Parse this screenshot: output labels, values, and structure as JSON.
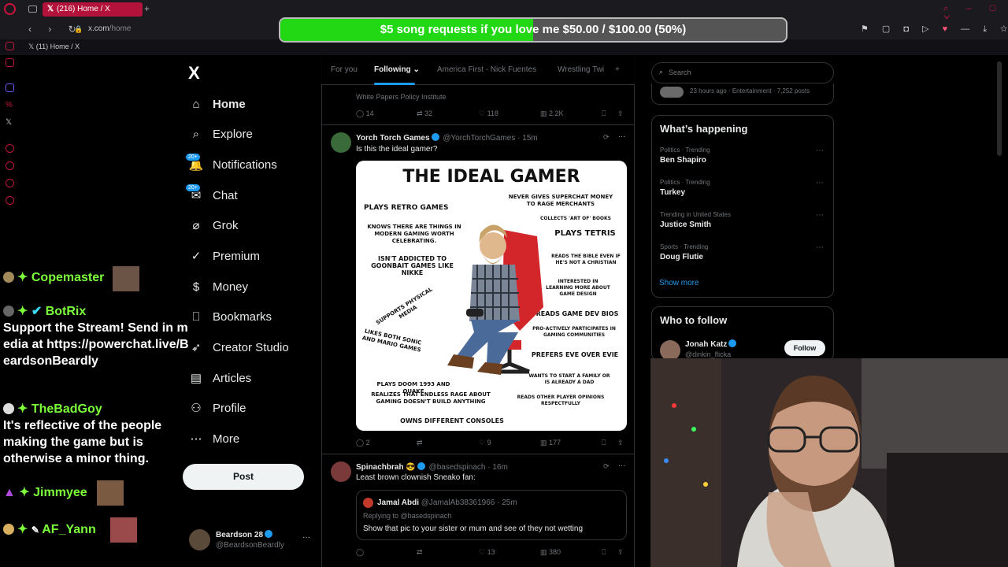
{
  "browser": {
    "tab_title": "(216) Home / X",
    "url_host": "x.com",
    "url_path": "/home",
    "bookmark": "(11) Home / X",
    "ai_label": "AI"
  },
  "donation": {
    "text": "$5 song requests if you love me $50.00 / $100.00 (50%)",
    "progress": 0.5
  },
  "nav": {
    "logo": "X",
    "items": [
      {
        "label": "Home",
        "icon": "home-icon",
        "glyph": "⌂"
      },
      {
        "label": "Explore",
        "icon": "search-icon",
        "glyph": "⌕"
      },
      {
        "label": "Notifications",
        "icon": "bell-icon",
        "glyph": "🔔",
        "badge": "20+"
      },
      {
        "label": "Chat",
        "icon": "envelope-icon",
        "glyph": "✉",
        "badge": "20+"
      },
      {
        "label": "Grok",
        "icon": "grok-icon",
        "glyph": "⌀"
      },
      {
        "label": "Premium",
        "icon": "premium-icon",
        "glyph": "✓"
      },
      {
        "label": "Money",
        "icon": "money-icon",
        "glyph": "$"
      },
      {
        "label": "Bookmarks",
        "icon": "bookmark-icon",
        "glyph": "⎕"
      },
      {
        "label": "Creator Studio",
        "icon": "rocket-icon",
        "glyph": "➶"
      },
      {
        "label": "Articles",
        "icon": "articles-icon",
        "glyph": "▤"
      },
      {
        "label": "Profile",
        "icon": "person-icon",
        "glyph": "⚇"
      },
      {
        "label": "More",
        "icon": "more-icon",
        "glyph": "⋯"
      }
    ],
    "post_button": "Post",
    "account": {
      "name": "Beardson 28",
      "handle": "@BeardsonBeardly",
      "more": "···"
    }
  },
  "chat": [
    {
      "user": "Copemaster",
      "message": ""
    },
    {
      "user": "BotRix",
      "message": "Support the Stream! Send in media at https://powerchat.live/BeardsonBeardly"
    },
    {
      "user": "TheBadGoy",
      "message": "It's reflective of the people making the game but is otherwise a minor thing."
    },
    {
      "user": "Jimmyee",
      "message": ""
    },
    {
      "user": "AF_Yann",
      "message": ""
    }
  ],
  "feed": {
    "tabs": [
      "For you",
      "Following",
      "America First - Nick Fuentes",
      "Wrestling Twi",
      "+"
    ],
    "prev_post": {
      "source": "White Papers Policy Institute",
      "replies": "14",
      "reposts": "32",
      "likes": "118",
      "views": "2.2K"
    },
    "post1": {
      "name": "Yorch Torch Games",
      "handle": "@YorchTorchGames · 15m",
      "text": "Is this the ideal gamer?",
      "replies": "2",
      "reposts": "",
      "likes": "9",
      "views": "177",
      "meme": {
        "title": "THE IDEAL GAMER",
        "labels": [
          "PLAYS RETRO GAMES",
          "KNOWS THERE ARE THINGS IN MODERN GAMING WORTH CELEBRATING.",
          "ISN'T ADDICTED TO GOONBAIT GAMES LIKE NIKKE",
          "SUPPORTS PHYSICAL MEDIA",
          "LIKES BOTH SONIC AND MARIO GAMES",
          "PLAYS DOOM 1993 AND QUAKE",
          "REALIZES THAT ENDLESS RAGE ABOUT GAMING DOESN'T BUILD ANYTHING",
          "OWNS DIFFERENT CONSOLES",
          "NEVER GIVES SUPERCHAT MONEY TO RAGE MERCHANTS",
          "COLLECTS 'ART OF' BOOKS",
          "PLAYS TETRIS",
          "READS THE BIBLE EVEN IF HE'S NOT A CHRISTIAN",
          "INTERESTED IN LEARNING MORE ABOUT GAME DESIGN",
          "READS GAME DEV BIOS",
          "PRO-ACTIVELY PARTICIPATES IN GAMING COMMUNITIES",
          "PREFERS EVE OVER EVIE",
          "WANTS TO START A FAMILY OR IS ALREADY A DAD",
          "READS OTHER PLAYER OPINIONS RESPECTFULLY"
        ]
      }
    },
    "post2": {
      "name": "Spinachbrah",
      "handle": "@basedspinach · 16m",
      "text": "Least brown clownish Sneako fan:",
      "quote": {
        "name": "Jamal Abdi",
        "handle": "@JamalAb38361966 · 25m",
        "reply": "Replying to @basedspinach",
        "text": "Show that pic to your sister or mum and see of they not wetting"
      },
      "replies": "",
      "reposts": "",
      "likes": "13",
      "views": "380"
    }
  },
  "right": {
    "search_placeholder": "Search",
    "news_meta": "23 hours ago · Entertainment · 7,252 posts",
    "happening_title": "What’s happening",
    "trends": [
      {
        "context": "Politics · Trending",
        "name": "Ben Shapiro"
      },
      {
        "context": "Politics · Trending",
        "name": "Turkey"
      },
      {
        "context": "Trending in United States",
        "name": "Justice Smith"
      },
      {
        "context": "Sports · Trending",
        "name": "Doug Flutie"
      }
    ],
    "show_more": "Show more",
    "wtf_title": "Who to follow",
    "suggestion": {
      "name": "Jonah Katz",
      "handle": "@dinkin_flicka",
      "follow": "Follow"
    }
  },
  "colors": {
    "accent": "#1d9bf0",
    "tab": "#b3123a",
    "donation_fill": "#22d814",
    "chat_name": "#7cff3a"
  }
}
